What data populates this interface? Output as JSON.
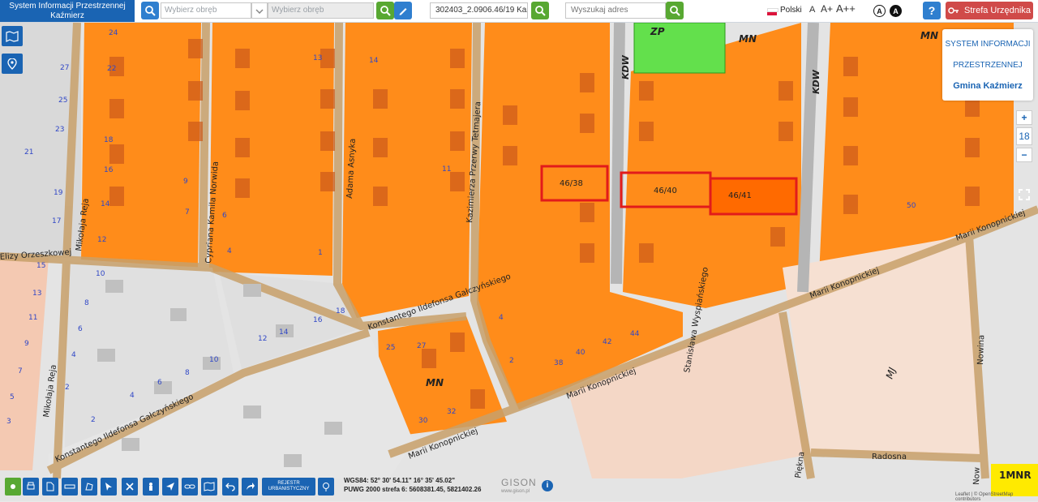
{
  "header": {
    "title_line1": "System Informacji Przestrzennej",
    "title_line2": "Kaźmierz",
    "precinct_placeholder_1": "Wybierz obręb",
    "precinct_placeholder_2": "Wybierz obręb",
    "parcel_value": "302403_2.0906.46/19 Kaźm",
    "address_placeholder": "Wyszukaj adres",
    "language": "Polski",
    "font_small": "A",
    "font_medium": "A+",
    "font_large": "A++",
    "contrast_1": "A",
    "contrast_2": "A",
    "help_label": "?",
    "strefa_label": "Strefa Urzędnika"
  },
  "panel": {
    "line1": "SYSTEM INFORMACJI",
    "line2": "PRZESTRZENNEJ",
    "line3": "Gmina Kaźmierz"
  },
  "zoom": {
    "level": "18",
    "plus": "+",
    "minus": "−"
  },
  "toolbar": {
    "rejestr_line1": "REJESTR",
    "rejestr_line2": "URBANISTYCZNY"
  },
  "coords": {
    "wgs": "WGS84: 52° 30' 54.11\" 16° 35' 45.02\"",
    "puwg": "PUWG 2000 strefa 6: 5608381.45, 5821402.26"
  },
  "logo": {
    "name": "GISON",
    "url": "www.gison.pl"
  },
  "attribution": "Leaflet | © OpenStreetMap contributors",
  "map": {
    "streets": [
      "Mikołaja Reja",
      "Mikołaja Reja",
      "Cypriana Kamila Norwida",
      "Adama Asnyka",
      "Kazimierza Przerwy Tetmajera",
      "Konstantego Ildefonsa Gałczyńskiego",
      "Konstantego Ildefonsa Gałczyńskiego",
      "Marii Konopnickiej",
      "Marii Konopnickiej",
      "Marii Konopnickiej",
      "Marii Konopnickiej",
      "Stanisława Wyspiańskiego",
      "Elizy Orzeszkowej",
      "Radosna",
      "Piękna",
      "Nowina",
      "Now"
    ],
    "zones": [
      "ZP",
      "MN",
      "MN",
      "MN",
      "KDW",
      "KDW",
      "MJ",
      "1MNR"
    ],
    "highlighted_parcels": [
      "46/38",
      "46/40",
      "46/41"
    ],
    "house_numbers": [
      "24",
      "22",
      "18",
      "16",
      "14",
      "12",
      "13",
      "9",
      "7",
      "6",
      "4",
      "14",
      "11",
      "1",
      "27",
      "25",
      "23",
      "21",
      "19",
      "17",
      "50",
      "15",
      "13",
      "11",
      "9",
      "7",
      "5",
      "3",
      "10",
      "8",
      "6",
      "4",
      "2",
      "12",
      "14",
      "16",
      "18",
      "10",
      "8",
      "6",
      "4",
      "2",
      "25",
      "27",
      "40",
      "42",
      "44",
      "38",
      "2",
      "4",
      "30",
      "32",
      "MN"
    ]
  },
  "colors": {
    "brand_blue": "#1a64b3",
    "strefa_red": "#d04a49",
    "search_green": "#58a832",
    "zone_orange": "#ff8c1a",
    "zone_green": "#63e04c",
    "road_grey": "#b5b5b5",
    "parcel_red": "#e21b1b",
    "mj_pink": "#f4c9b2"
  },
  "icons": [
    "map-icon",
    "location-pin-icon",
    "search-icon",
    "edit-icon",
    "print-icon",
    "document-icon",
    "measure-icon",
    "info-icon",
    "fullscreen-icon"
  ]
}
